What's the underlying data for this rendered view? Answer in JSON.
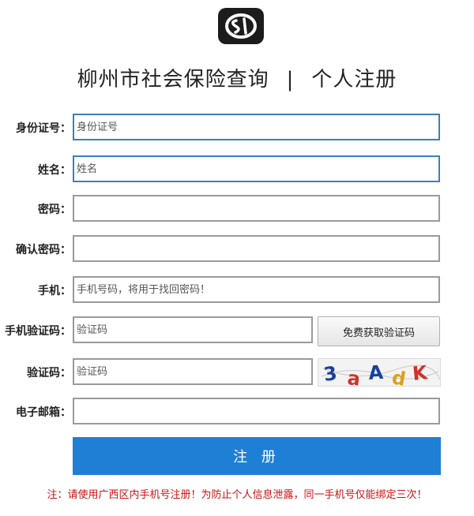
{
  "header": {
    "logo_icon": "si-logo-icon",
    "site_title": "柳州市社会保险查询",
    "separator": "|",
    "page_title": "个人注册"
  },
  "form": {
    "id_card": {
      "label": "身份证号：",
      "placeholder": "身份证号"
    },
    "name": {
      "label": "姓名：",
      "placeholder": "姓名"
    },
    "password": {
      "label": "密码：",
      "placeholder": ""
    },
    "confirm_password": {
      "label": "确认密码：",
      "placeholder": ""
    },
    "phone": {
      "label": "手机：",
      "placeholder": "手机号码，将用于找回密码！"
    },
    "sms_code": {
      "label": "手机验证码：",
      "placeholder": "验证码",
      "button_label": "免费获取验证码"
    },
    "captcha": {
      "label": "验证码：",
      "placeholder": "验证码",
      "image_text": "3aAdK"
    },
    "email": {
      "label": "电子邮箱：",
      "placeholder": ""
    },
    "submit_label": "注 册"
  },
  "notice": "注：请使用广西区内手机号注册！为防止个人信息泄露，同一手机号仅能绑定三次！",
  "colors": {
    "focus_border": "#3c7fc0",
    "submit_bg": "#1f7fd5",
    "notice_text": "#cc1111"
  }
}
